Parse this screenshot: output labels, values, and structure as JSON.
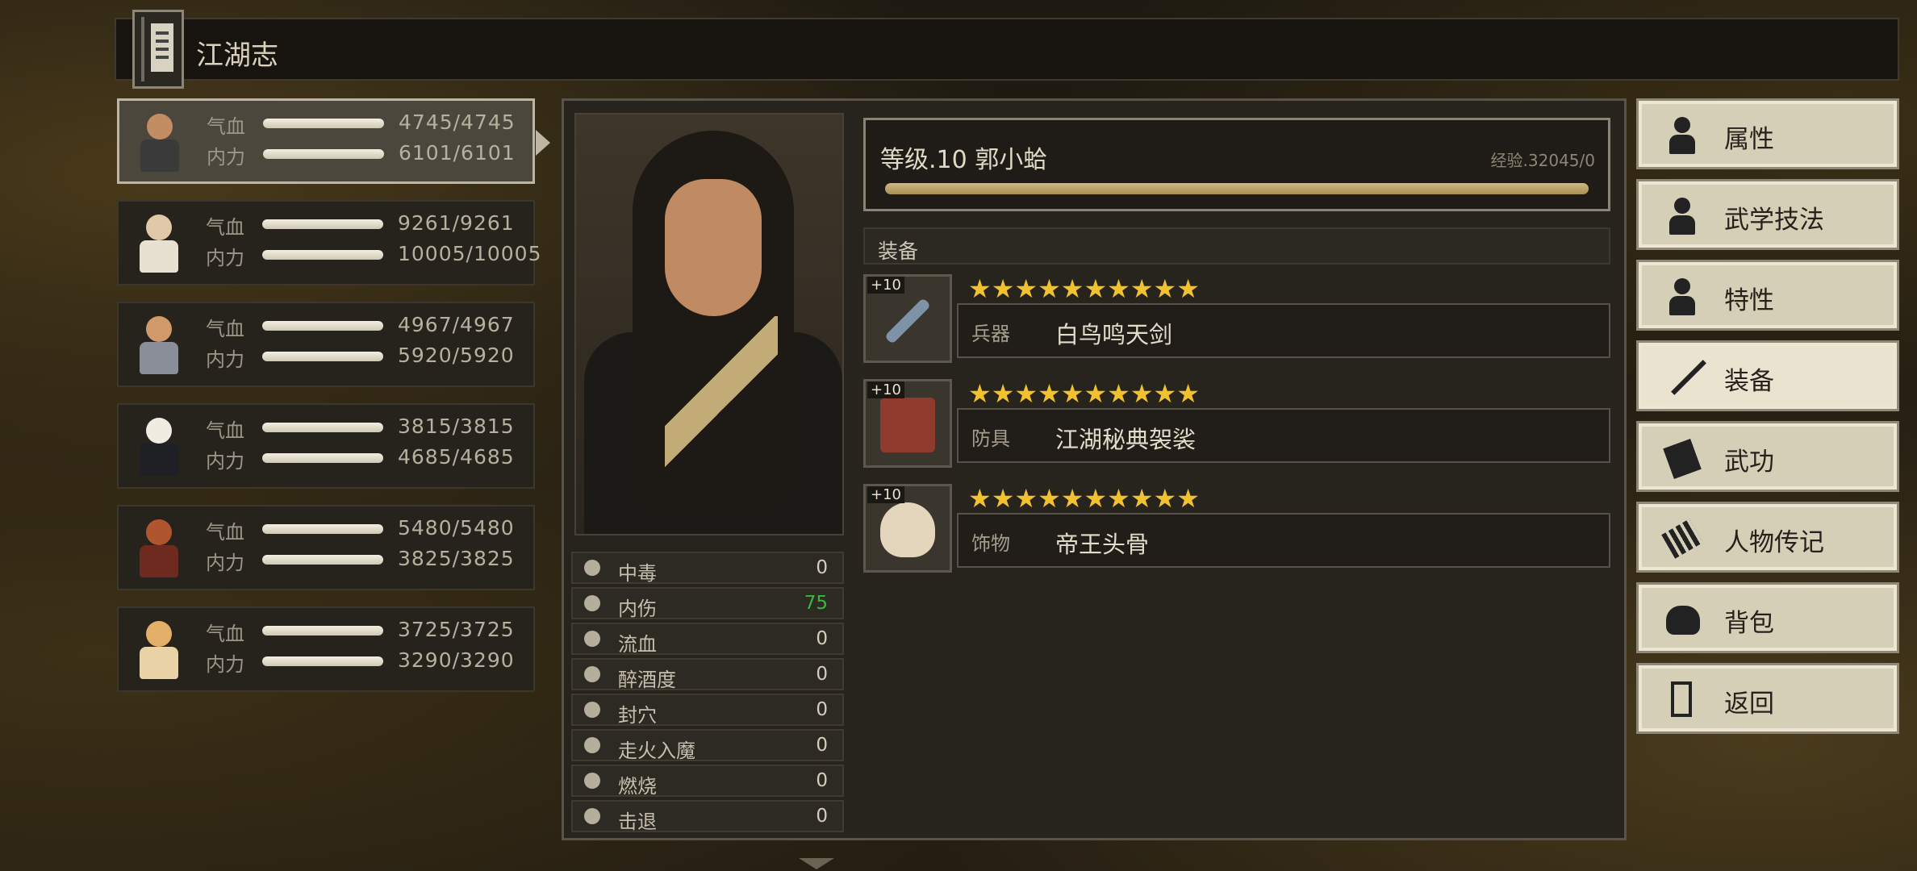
{
  "title": "江湖志",
  "roster": [
    {
      "hp_label": "气血",
      "hp": "4745/4745",
      "mp_label": "内力",
      "mp": "6101/6101",
      "selected": true,
      "head": "#c28d62",
      "body": "#3a3a3a"
    },
    {
      "hp_label": "气血",
      "hp": "9261/9261",
      "mp_label": "内力",
      "mp": "10005/10005",
      "selected": false,
      "head": "#e0c8a8",
      "body": "#e8e0d0"
    },
    {
      "hp_label": "气血",
      "hp": "4967/4967",
      "mp_label": "内力",
      "mp": "5920/5920",
      "selected": false,
      "head": "#d09a6a",
      "body": "#8a8e98"
    },
    {
      "hp_label": "气血",
      "hp": "3815/3815",
      "mp_label": "内力",
      "mp": "4685/4685",
      "selected": false,
      "head": "#f0ece2",
      "body": "#1f1f26"
    },
    {
      "hp_label": "气血",
      "hp": "5480/5480",
      "mp_label": "内力",
      "mp": "3825/3825",
      "selected": false,
      "head": "#b0562e",
      "body": "#6e2a1e"
    },
    {
      "hp_label": "气血",
      "hp": "3725/3725",
      "mp_label": "内力",
      "mp": "3290/3290",
      "selected": false,
      "head": "#e3b06a",
      "body": "#e8d2a6"
    }
  ],
  "character": {
    "level_line": "等级.10 郭小蛤",
    "exp_text": "经验.32045/0",
    "exp_fraction": 1.0
  },
  "status": [
    {
      "icon": "skull-icon",
      "label": "中毒",
      "value": "0",
      "highlight": false
    },
    {
      "icon": "broken-heart-icon",
      "label": "内伤",
      "value": "75",
      "highlight": true
    },
    {
      "icon": "blood-icon",
      "label": "流血",
      "value": "0",
      "highlight": false
    },
    {
      "icon": "drunk-icon",
      "label": "醉酒度",
      "value": "0",
      "highlight": false
    },
    {
      "icon": "acupoint-icon",
      "label": "封穴",
      "value": "0",
      "highlight": false
    },
    {
      "icon": "demon-icon",
      "label": "走火入魔",
      "value": "0",
      "highlight": false
    },
    {
      "icon": "fire-icon",
      "label": "燃烧",
      "value": "0",
      "highlight": false
    },
    {
      "icon": "boot-icon",
      "label": "击退",
      "value": "0",
      "highlight": false
    }
  ],
  "equipment": {
    "header": "装备",
    "items": [
      {
        "plus": "+10",
        "stars": 10,
        "type": "兵器",
        "name": "白鸟鸣天剑",
        "icon": "sword-icon",
        "color": "#7f93a8"
      },
      {
        "plus": "+10",
        "stars": 10,
        "type": "防具",
        "name": "江湖秘典袈裟",
        "icon": "robe-icon",
        "color": "#8e3a2c"
      },
      {
        "plus": "+10",
        "stars": 10,
        "type": "饰物",
        "name": "帝王头骨",
        "icon": "skull-icon",
        "color": "#e4d6bd"
      }
    ]
  },
  "menu": [
    {
      "label": "属性",
      "icon": "person-icon",
      "active": false
    },
    {
      "label": "武学技法",
      "icon": "person-spark-icon",
      "active": false
    },
    {
      "label": "特性",
      "icon": "person-heart-icon",
      "active": false
    },
    {
      "label": "装备",
      "icon": "sword-icon",
      "active": true
    },
    {
      "label": "武功",
      "icon": "book-icon",
      "active": false
    },
    {
      "label": "人物传记",
      "icon": "scroll-icon",
      "active": false
    },
    {
      "label": "背包",
      "icon": "bag-icon",
      "active": false
    },
    {
      "label": "返回",
      "icon": "door-icon",
      "active": false
    }
  ]
}
